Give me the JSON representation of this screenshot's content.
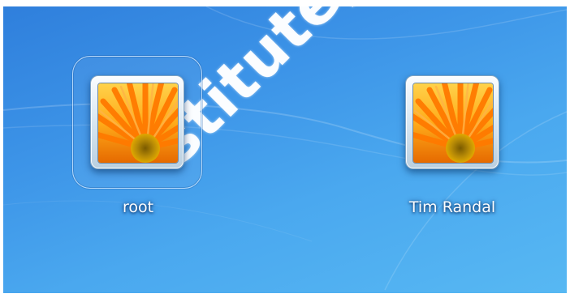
{
  "login_screen": {
    "users": [
      {
        "name": "root",
        "avatar": "orange-flower-icon",
        "selected": true
      },
      {
        "name": "Tim Randal",
        "avatar": "orange-flower-icon",
        "selected": false
      }
    ],
    "watermark": "stitute, Autho"
  },
  "colors": {
    "wallpaper_dark": "#2f7fdc",
    "wallpaper_light": "#57b8f3",
    "petal": "#ff8c00",
    "flower_center": "#c79a0a"
  }
}
